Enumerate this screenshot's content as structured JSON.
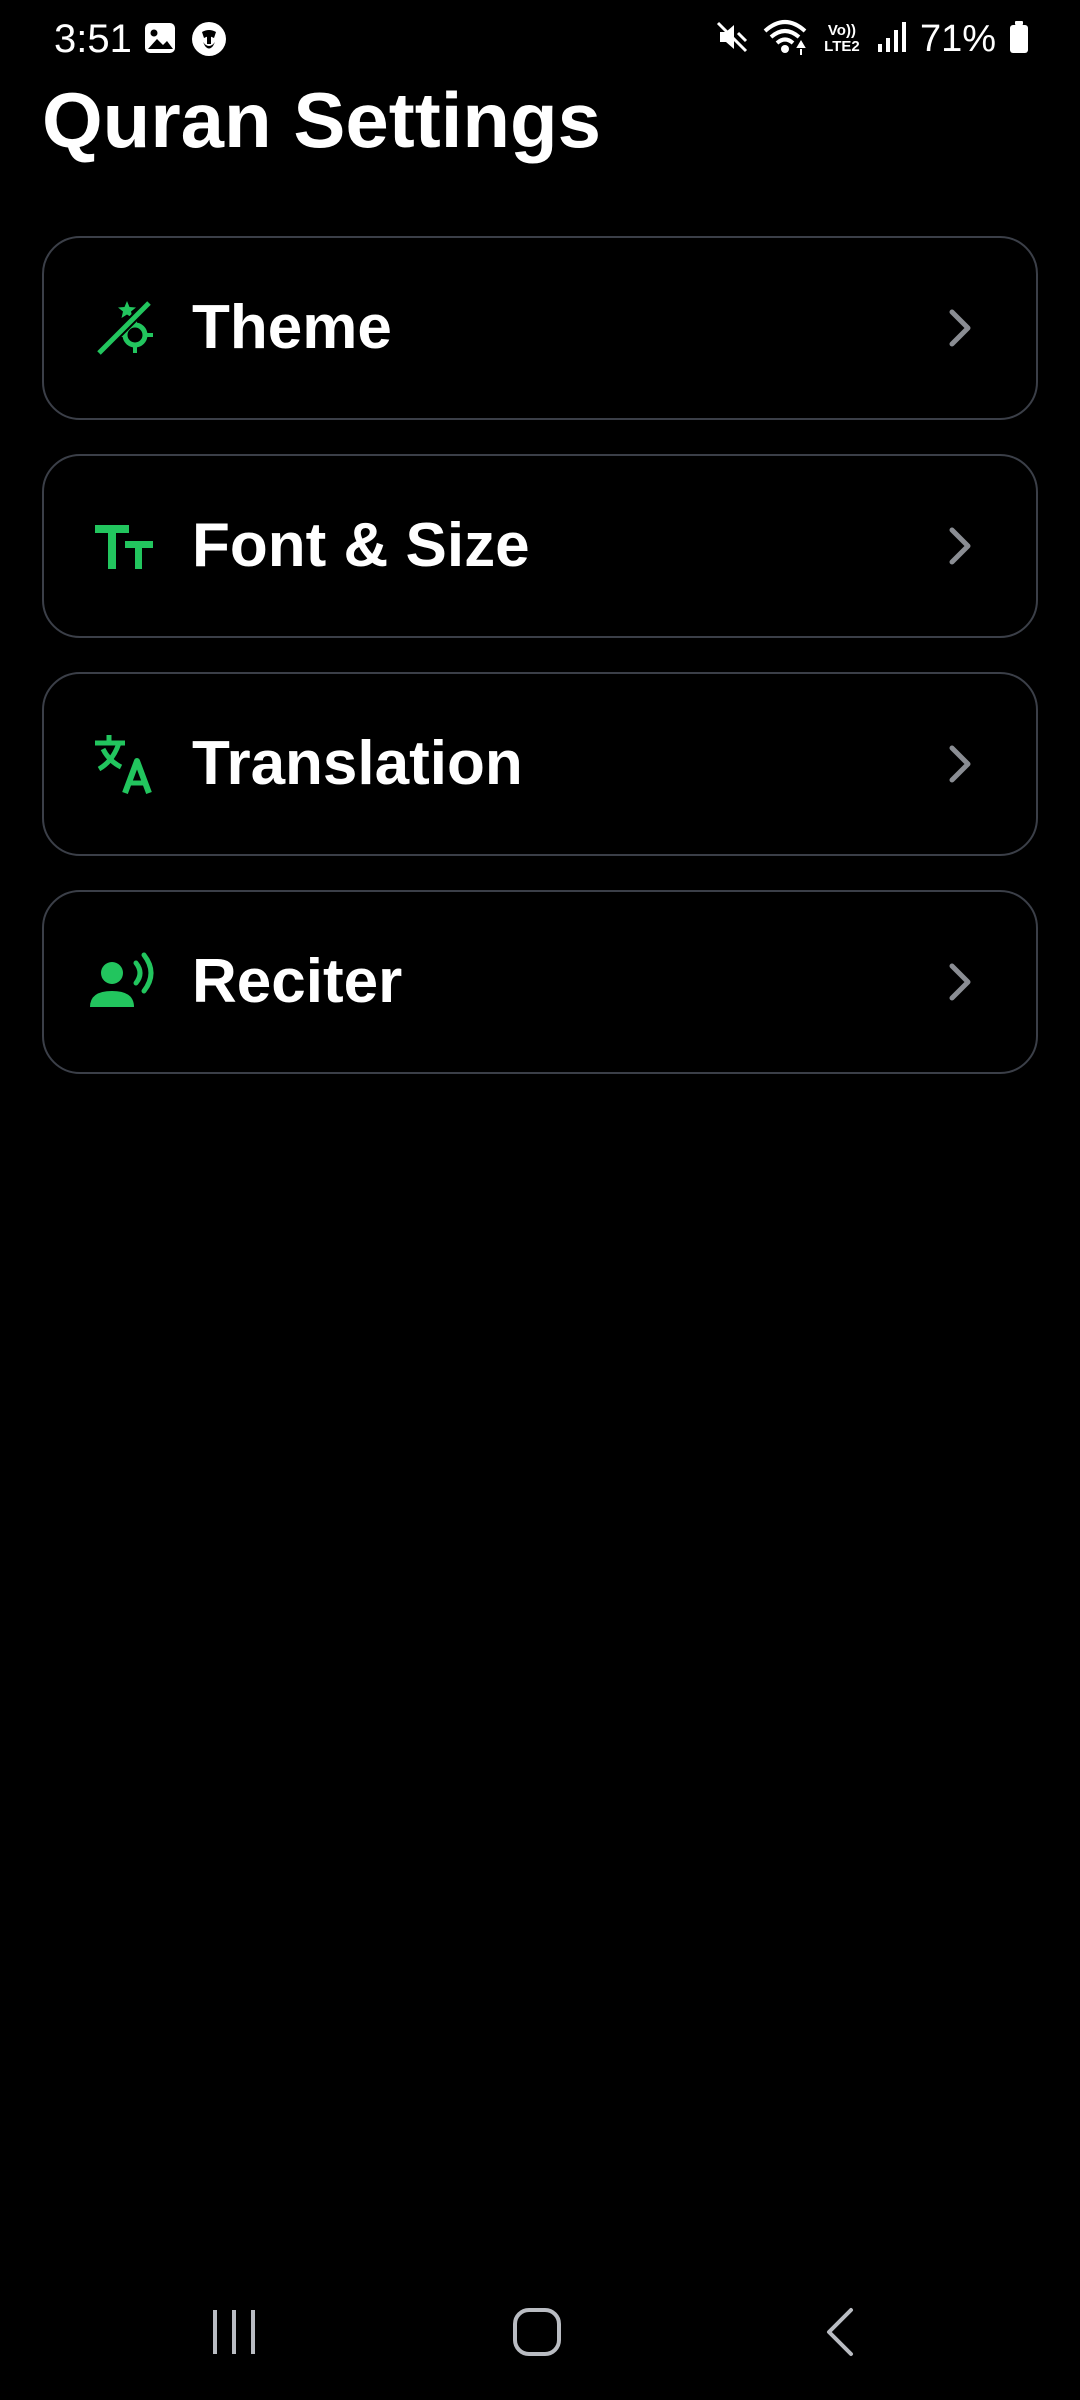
{
  "status_bar": {
    "time": "3:51",
    "battery": "71%",
    "network_label_top": "Vo))",
    "network_label_bottom": "LTE2",
    "left_icons": [
      "gallery-icon",
      "messenger-icon"
    ],
    "right_icons": [
      "mute-icon",
      "wifi-icon",
      "signal-icon",
      "battery-icon"
    ]
  },
  "header": {
    "title": "Quran Settings"
  },
  "settings": {
    "accent_color": "#22c55e",
    "items": [
      {
        "label": "Theme",
        "icon": "theme-icon"
      },
      {
        "label": "Font & Size",
        "icon": "font-size-icon"
      },
      {
        "label": "Translation",
        "icon": "translate-icon"
      },
      {
        "label": "Reciter",
        "icon": "reciter-icon"
      }
    ]
  },
  "nav_bar": {
    "buttons": [
      "recents-button",
      "home-button",
      "back-button"
    ]
  }
}
